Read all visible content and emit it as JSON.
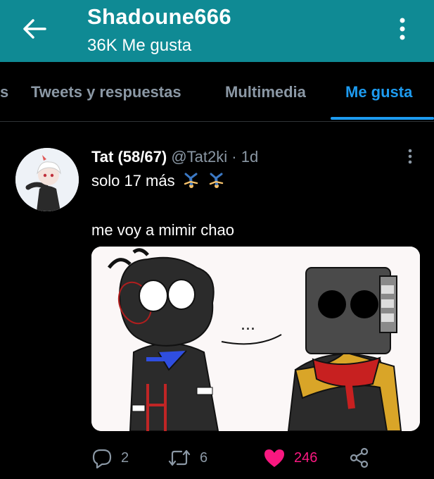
{
  "header": {
    "title": "Shadoune666",
    "subtitle": "36K Me gusta"
  },
  "tabs": {
    "edge_fragment": "s",
    "items": [
      {
        "label": "Tweets y respuestas"
      },
      {
        "label": "Multimedia"
      },
      {
        "label": "Me gusta"
      }
    ],
    "active_index": 2
  },
  "tweet": {
    "display_name": "Tat (58/67)",
    "handle": "@Tat2ki",
    "separator": "·",
    "time": "1d",
    "text_line1": "solo 17 más",
    "text_line2": "me voy a mimir chao",
    "image_text": "...",
    "actions": {
      "replies": "2",
      "retweets": "6",
      "likes": "246"
    }
  },
  "colors": {
    "header_bg": "#0f8a94",
    "accent": "#1d9bf0",
    "like": "#f91880",
    "muted": "#8b98a5"
  },
  "icons": [
    "back-arrow-icon",
    "more-vertical-icon",
    "reply-icon",
    "retweet-icon",
    "heart-icon",
    "share-icon",
    "breakdancer-emoji"
  ]
}
